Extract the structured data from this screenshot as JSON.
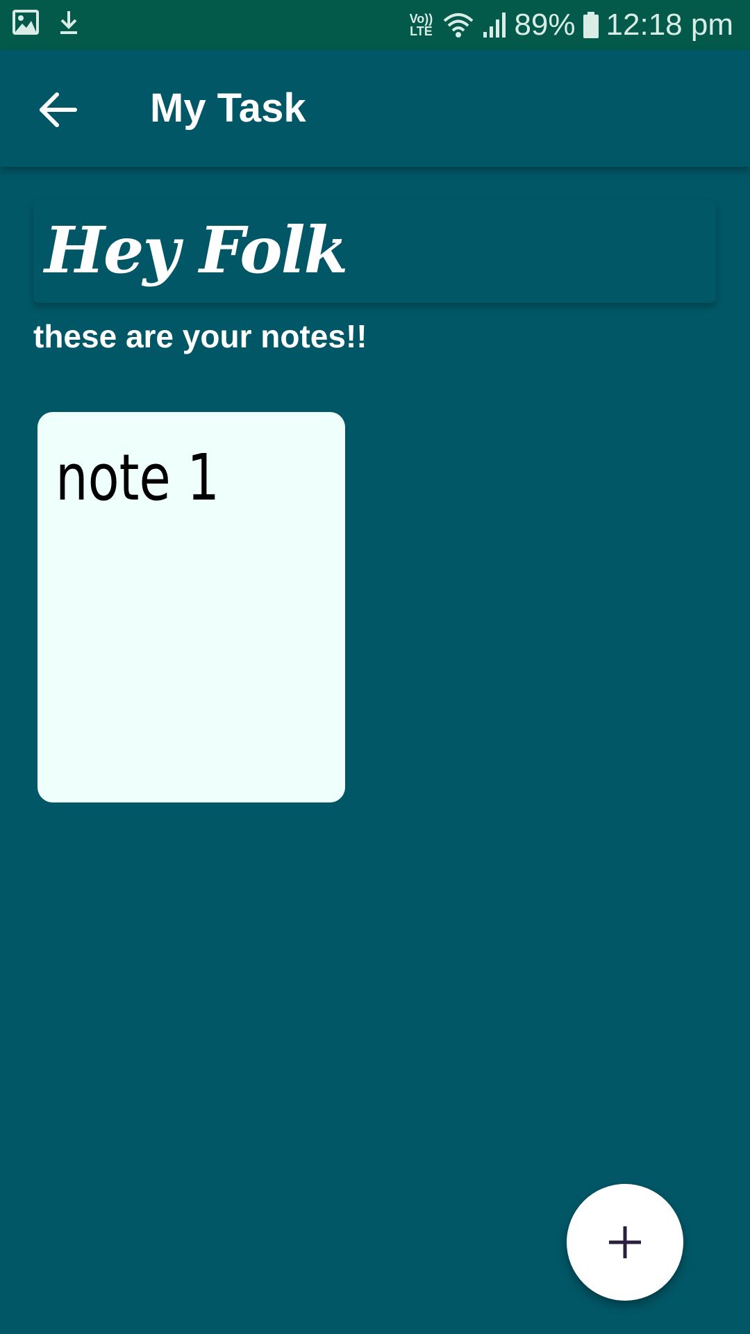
{
  "status_bar": {
    "left_icons": [
      "image-icon",
      "download-icon"
    ],
    "network_label": "Vo))\nLTE",
    "battery_percent": "89%",
    "time": "12:18 pm",
    "icons": [
      "volte-icon",
      "wifi-icon",
      "signal-icon",
      "battery-icon"
    ]
  },
  "app_bar": {
    "title": "My Task",
    "back_icon": "arrow-left-icon"
  },
  "header": {
    "greeting": "Hey Folk",
    "subtitle": "these are your notes!!"
  },
  "notes": [
    {
      "title": "note 1"
    }
  ],
  "fab": {
    "icon": "plus-icon"
  },
  "colors": {
    "status_bar": "#03594a",
    "background": "#025767",
    "note_card": "#effffb",
    "fab": "#ffffff",
    "fab_icon": "#2a1f3d"
  }
}
